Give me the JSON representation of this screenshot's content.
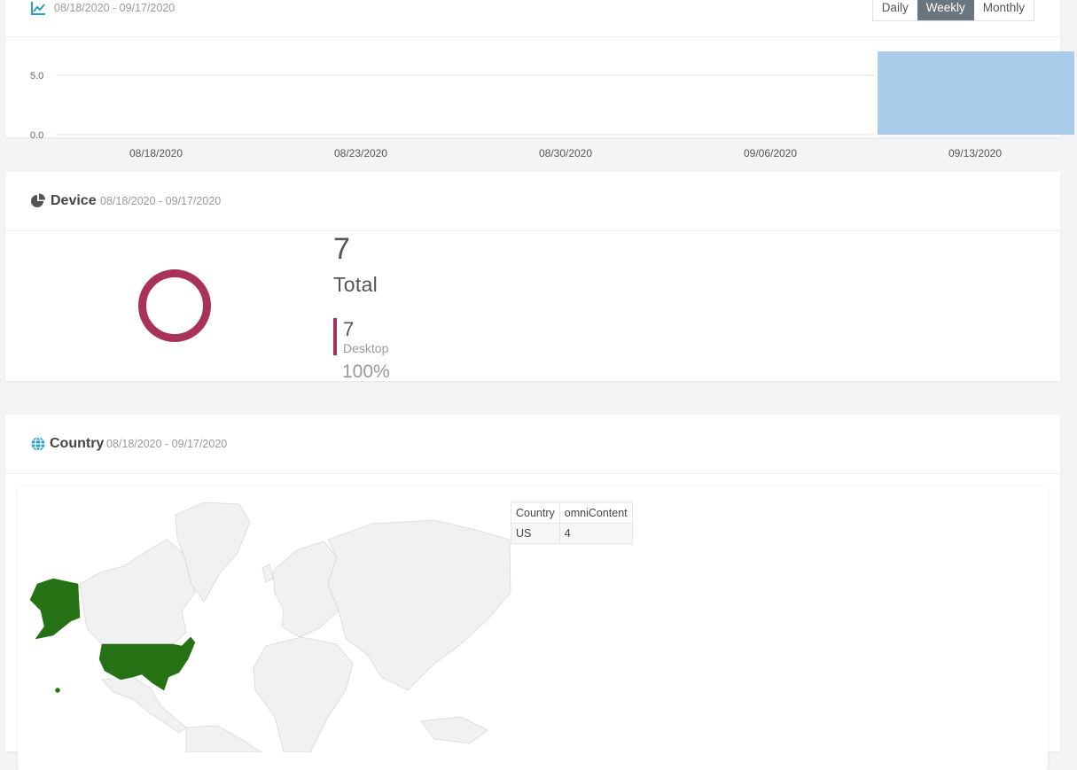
{
  "top_card": {
    "date_range": "08/18/2020 - 09/17/2020",
    "icon": "line-chart-icon",
    "toggle": {
      "daily": "Daily",
      "weekly": "Weekly",
      "monthly": "Monthly",
      "active": "Weekly"
    }
  },
  "chart_data": {
    "type": "bar",
    "categories": [
      "08/18/2020",
      "08/23/2020",
      "08/30/2020",
      "09/06/2020",
      "09/13/2020"
    ],
    "values": [
      0,
      0,
      0,
      0,
      7
    ],
    "yticks": [
      "5.0",
      "0.0"
    ],
    "ylim": [
      0,
      7
    ],
    "bar_color": "#abcbea",
    "title": "",
    "xlabel": "",
    "ylabel": ""
  },
  "device_card": {
    "title": "Device",
    "date_range": "08/18/2020 - 09/17/2020",
    "icon": "pie-chart-icon",
    "total_value": "7",
    "total_label": "Total",
    "items": [
      {
        "value": "7",
        "label": "Desktop",
        "percent": "100%",
        "color": "#a8325a"
      }
    ]
  },
  "country_card": {
    "title": "Country",
    "date_range": "08/18/2020 - 09/17/2020",
    "icon": "globe-icon",
    "highlight_color": "#267114",
    "table": {
      "headers": [
        "Country",
        "omniContent"
      ],
      "rows": [
        [
          "US",
          "4"
        ]
      ]
    }
  }
}
